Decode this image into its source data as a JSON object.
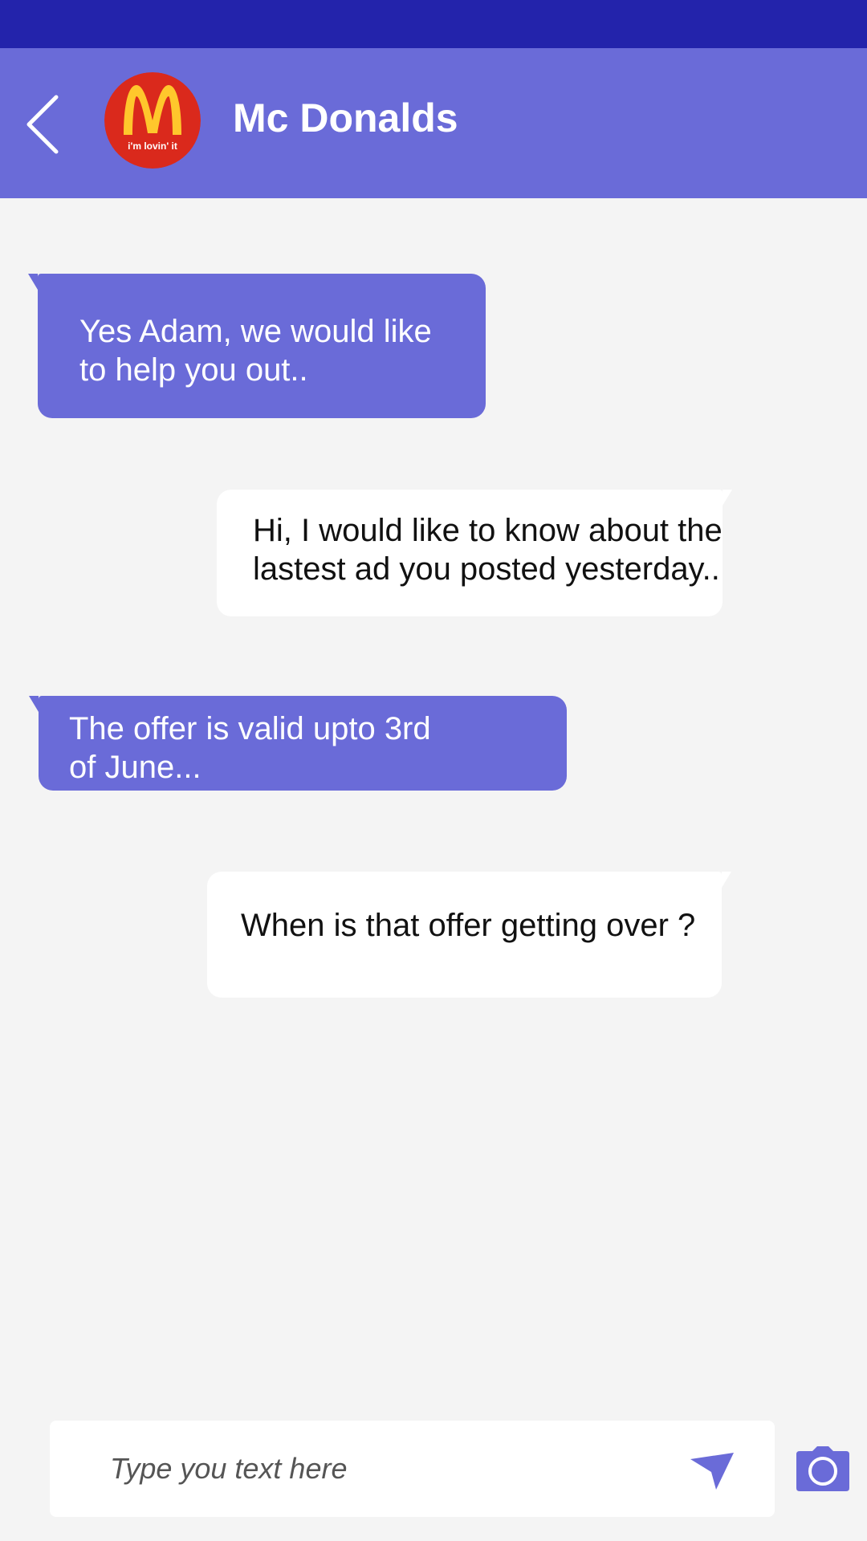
{
  "colors": {
    "status_bar": "#2323ab",
    "header": "#6a6bd8",
    "accent": "#6a6bd8",
    "background": "#f4f4f4",
    "incoming_bubble": "#6a6bd8",
    "outgoing_bubble": "#ffffff",
    "logo_red": "#da291c",
    "logo_yellow": "#ffc72c"
  },
  "header": {
    "back_icon": "chevron-left-icon",
    "avatar_icon": "mcdonalds-logo",
    "title": "Mc Donalds"
  },
  "messages": [
    {
      "direction": "incoming",
      "text": "Yes Adam, we would like\nto help you out.."
    },
    {
      "direction": "outgoing",
      "text": "Hi, I would like to know about the\nlastest ad you posted yesterday.."
    },
    {
      "direction": "incoming",
      "text": "The offer is valid upto 3rd\nof June..."
    },
    {
      "direction": "outgoing",
      "text": "When is that  offer getting over ?"
    }
  ],
  "composer": {
    "placeholder": "Type you text here",
    "value": "",
    "send_icon": "send-icon",
    "camera_icon": "camera-icon"
  }
}
